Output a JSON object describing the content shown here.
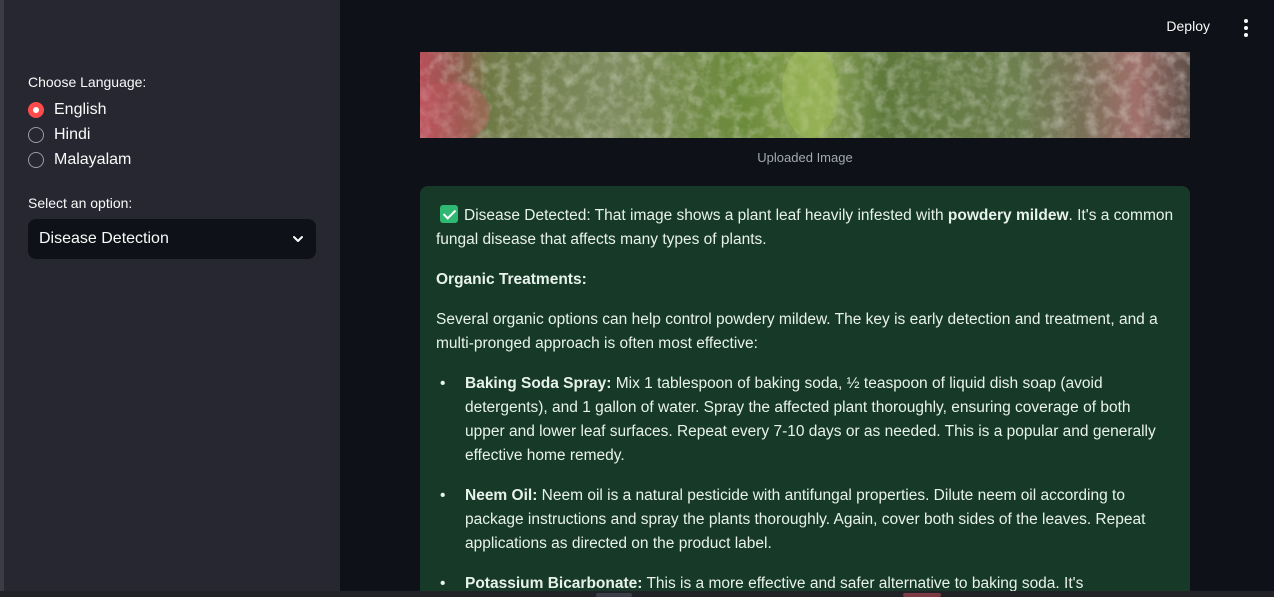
{
  "sidebar": {
    "language_label": "Choose Language:",
    "languages": [
      {
        "label": "English",
        "checked": true
      },
      {
        "label": "Hindi",
        "checked": false
      },
      {
        "label": "Malayalam",
        "checked": false
      }
    ],
    "option_label": "Select an option:",
    "option_selected": "Disease Detection"
  },
  "header": {
    "deploy_label": "Deploy",
    "menu_icon": "kebab-menu-icon"
  },
  "main": {
    "image_caption": "Uploaded Image",
    "result": {
      "status_icon": "check-mark-icon",
      "intro_prefix": "Disease Detected: That image shows a plant leaf heavily infested with ",
      "intro_bold": "powdery mildew",
      "intro_suffix": ". It's a common fungal disease that affects many types of plants.",
      "heading": "Organic Treatments:",
      "paragraph": "Several organic options can help control powdery mildew. The key is early detection and treatment, and a multi-pronged approach is often most effective:",
      "items": [
        {
          "title": "Baking Soda Spray:",
          "text": " Mix 1 tablespoon of baking soda, ½ teaspoon of liquid dish soap (avoid detergents), and 1 gallon of water. Spray the affected plant thoroughly, ensuring coverage of both upper and lower leaf surfaces. Repeat every 7-10 days or as needed. This is a popular and generally effective home remedy."
        },
        {
          "title": "Neem Oil:",
          "text": " Neem oil is a natural pesticide with antifungal properties. Dilute neem oil according to package instructions and spray the plants thoroughly. Again, cover both sides of the leaves. Repeat applications as directed on the product label."
        },
        {
          "title": "Potassium Bicarbonate:",
          "text": " This is a more effective and safer alternative to baking soda. It's commercially available as a fungicide. Follow the product label instructions carefully."
        }
      ]
    }
  },
  "colors": {
    "app_bg": "#0e1117",
    "sidebar_bg": "#262730",
    "accent": "#ff4b4b",
    "success_bg": "#173928",
    "success_icon": "#2fb872"
  }
}
